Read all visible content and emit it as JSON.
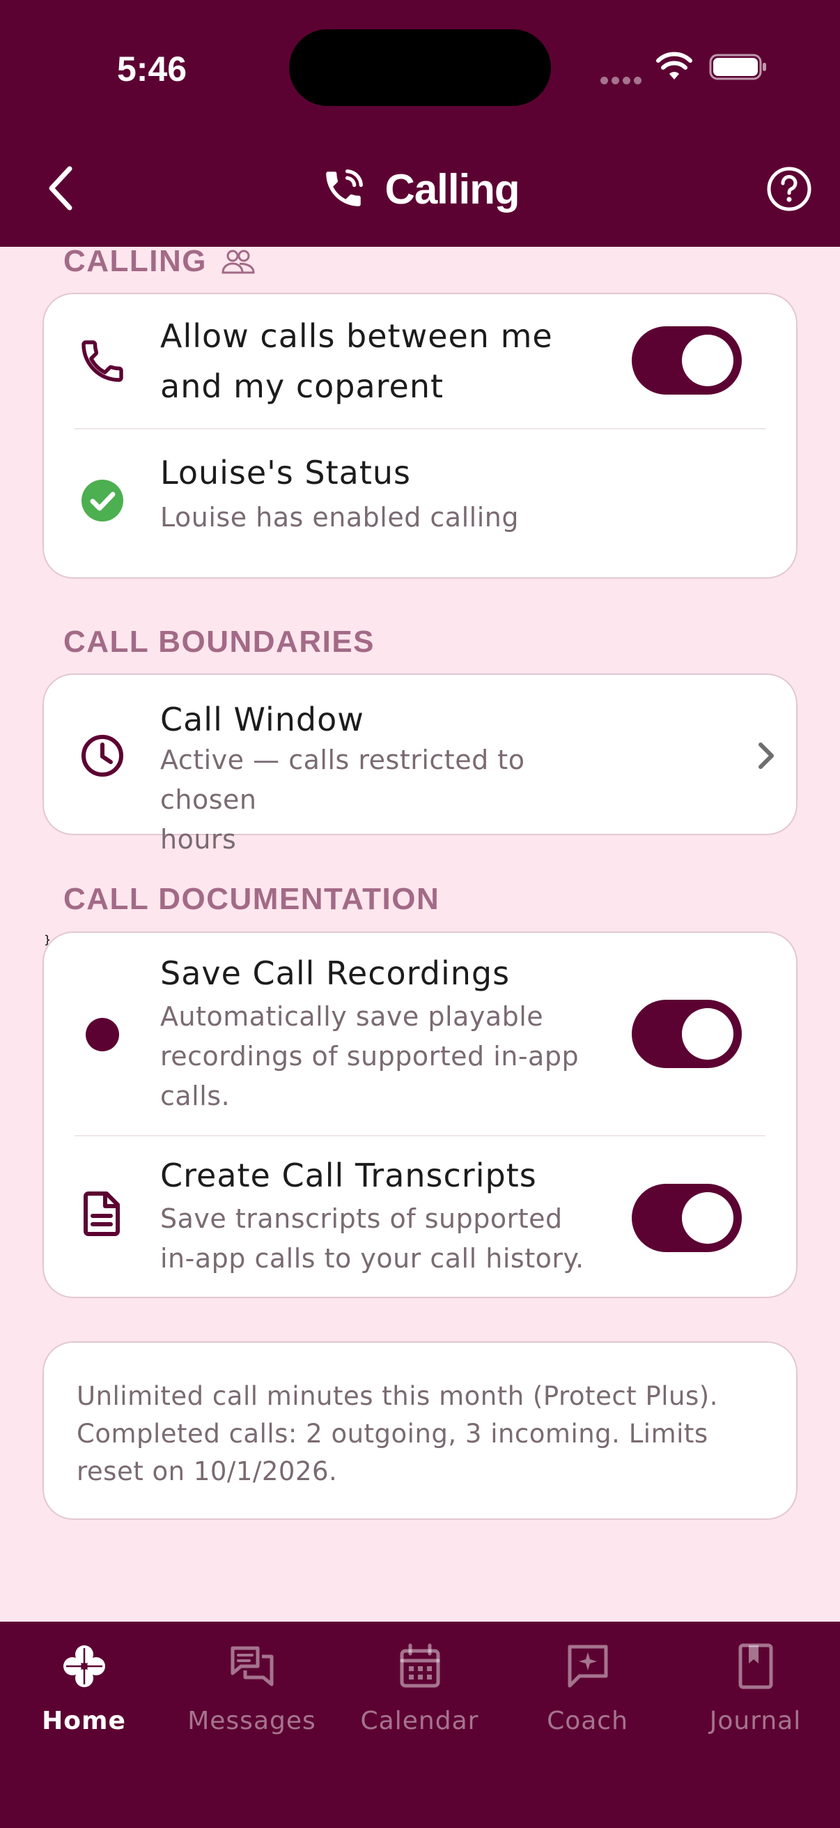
{
  "status_bar": {
    "time": "5:46"
  },
  "header": {
    "title": "Calling"
  },
  "sections": {
    "calling": {
      "label": "CALLING",
      "allow_calls": {
        "title_line1": "Allow calls between me",
        "title_line2": "and my coparent",
        "enabled": true
      },
      "coparent_status": {
        "title": "Louise's Status",
        "subtitle": "Louise has enabled calling"
      }
    },
    "boundaries": {
      "label": "CALL BOUNDARIES",
      "call_window": {
        "title": "Call Window",
        "subtitle_line1": "Active — calls restricted to chosen",
        "subtitle_line2": "hours"
      }
    },
    "documentation": {
      "label": "CALL DOCUMENTATION",
      "recordings": {
        "title": "Save Call Recordings",
        "subtitle_line1": "Automatically save playable",
        "subtitle_line2": "recordings of supported in-app",
        "subtitle_line3": "calls.",
        "enabled": true
      },
      "transcripts": {
        "title": "Create Call Transcripts",
        "subtitle_line1": "Save transcripts of supported",
        "subtitle_line2": "in-app calls to your call history.",
        "enabled": true
      }
    }
  },
  "usage_info": {
    "line1": "Unlimited call minutes this month (Protect Plus).",
    "line2": "Completed calls: 2 outgoing, 3 incoming. Limits",
    "line3": "reset on 10/1/2026."
  },
  "bottom_nav": {
    "items": [
      {
        "label": "Home",
        "icon": "clover-icon",
        "active": true
      },
      {
        "label": "Messages",
        "icon": "messages-icon",
        "active": false
      },
      {
        "label": "Calendar",
        "icon": "calendar-icon",
        "active": false
      },
      {
        "label": "Coach",
        "icon": "coach-sparkle-icon",
        "active": false
      },
      {
        "label": "Journal",
        "icon": "journal-bookmark-icon",
        "active": false
      }
    ]
  },
  "colors": {
    "brand": "#5c0232",
    "background": "#fde6ed",
    "section_label": "#a26a86",
    "success": "#4caf50"
  }
}
